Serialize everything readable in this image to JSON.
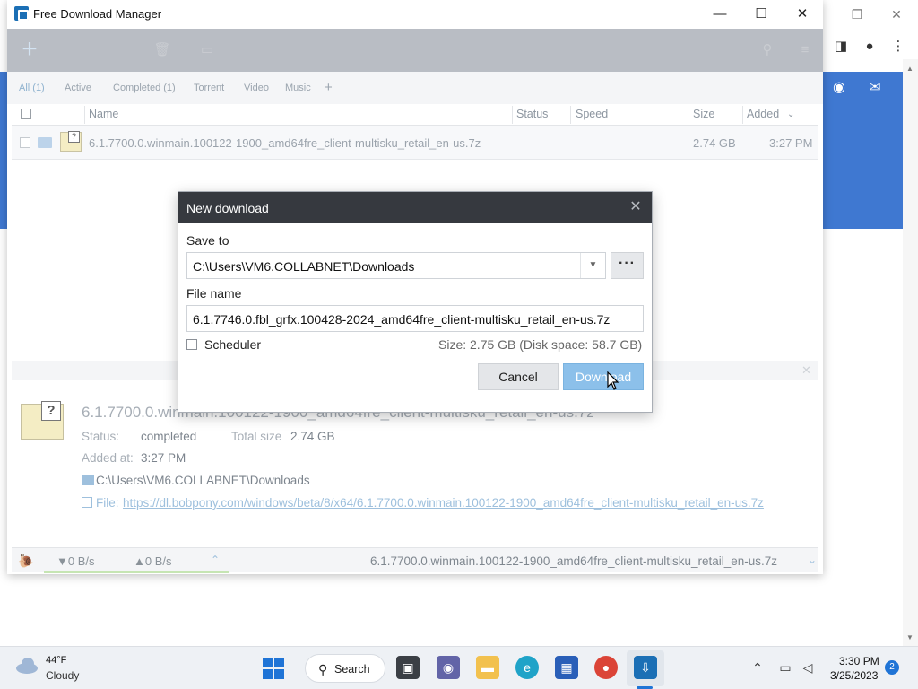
{
  "app": {
    "title": "Free Download Manager"
  },
  "filters": [
    "All (1)",
    "Active",
    "Completed (1)",
    "Torrent",
    "Video",
    "Music",
    "+"
  ],
  "columns": {
    "name": "Name",
    "status": "Status",
    "speed": "Speed",
    "size": "Size",
    "added": "Added"
  },
  "download_row": {
    "file_name": "6.1.7700.0.winmain.100122-1900_amd64fre_client-multisku_retail_en-us.7z",
    "size": "2.74 GB",
    "added": "3:27 PM"
  },
  "details": {
    "file_name": "6.1.7700.0.winmain.100122-1900_amd64fre_client-multisku_retail_en-us.7z",
    "status_label": "Status:",
    "status_value": "completed",
    "total_size_label": "Total size",
    "total_size_value": "2.74 GB",
    "added_label": "Added at:",
    "added_value": "3:27 PM",
    "folder_path": "C:\\Users\\VM6.COLLABNET\\Downloads",
    "file_label": "File:",
    "url": "https://dl.bobpony.com/windows/beta/8/x64/6.1.7700.0.winmain.100122-1900_amd64fre_client-multisku_retail_en-us.7z"
  },
  "statusbar": {
    "down_speed": "▼0 B/s",
    "up_speed": "▲0 B/s",
    "current_file": "6.1.7700.0.winmain.100122-1900_amd64fre_client-multisku_retail_en-us.7z"
  },
  "dialog": {
    "title": "New download",
    "save_to_label": "Save to",
    "save_to_value": "C:\\Users\\VM6.COLLABNET\\Downloads",
    "browse_label": "···",
    "file_name_label": "File name",
    "file_name_value": "6.1.7746.0.fbl_grfx.100428-2024_amd64fre_client-multisku_retail_en-us.7z",
    "scheduler_label": "Scheduler",
    "size_info": "Size: 2.75 GB (Disk space: 58.7 GB)",
    "cancel_label": "Cancel",
    "download_label": "Download"
  },
  "taskbar": {
    "weather_temp": "44°F",
    "weather_desc": "Cloudy",
    "search_label": "Search",
    "time": "3:30 PM",
    "date": "3/25/2023",
    "notification_count": "2"
  },
  "icons": {
    "add": "plus-icon",
    "delete": "trash-icon",
    "folder": "folder-icon",
    "search": "search-icon",
    "menu": "hamburger-icon",
    "github": "github-icon",
    "mail": "mail-icon"
  },
  "colors": {
    "toolbar": "#b9bdc4",
    "dialog_header": "#36393f",
    "primary_button": "#8cc0ea",
    "link": "#9ec0dd",
    "accent_blue": "#3f78d1"
  }
}
